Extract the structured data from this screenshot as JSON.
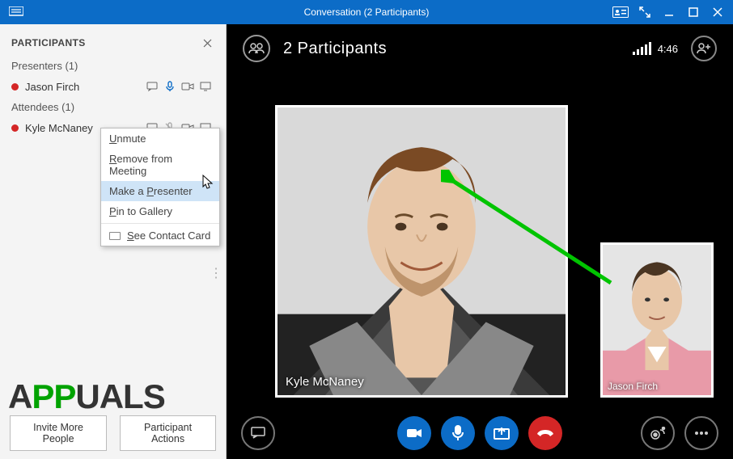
{
  "window": {
    "title": "Conversation (2 Participants)"
  },
  "sidebar": {
    "heading": "PARTICIPANTS",
    "presenters_label": "Presenters (1)",
    "attendees_label": "Attendees (1)",
    "presenters": [
      {
        "name": "Jason Firch"
      }
    ],
    "attendees": [
      {
        "name": "Kyle McNaney"
      }
    ],
    "invite_label": "Invite More People",
    "actions_label": "Participant Actions"
  },
  "context_menu": {
    "items": [
      {
        "label": "Unmute",
        "accel": "U"
      },
      {
        "label": "Remove from Meeting",
        "accel": "R"
      },
      {
        "label": "Make a Presenter",
        "accel": "P",
        "hover": true
      },
      {
        "label": "Pin to Gallery",
        "accel": "P"
      },
      {
        "label": "See Contact Card",
        "accel": "S",
        "icon": true
      }
    ]
  },
  "stage": {
    "header_label": "2 Participants",
    "time": "4:46",
    "main_video_name": "Kyle McNaney",
    "secondary_video_name": "Jason Firch"
  },
  "watermark": {
    "text_prefix": "A",
    "text_green": "PP",
    "text_suffix": "UALS"
  }
}
